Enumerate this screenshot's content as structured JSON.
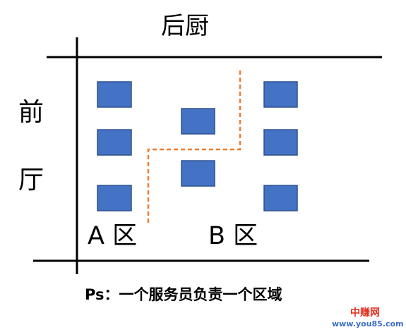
{
  "diagram": {
    "kitchen_label": "后厨",
    "front_hall_label_line1": "前",
    "front_hall_label_line2": "厅",
    "zone_a_label": "A 区",
    "zone_b_label": "B 区",
    "note": "Ps：一个服务员负责一个区域"
  },
  "watermark": {
    "site_name": "中赚网",
    "url": "www.you85.com"
  },
  "colors": {
    "table_fill": "#4472c4",
    "table_stroke": "#2f528f",
    "divider_line": "#ed7d31",
    "wall_line": "#000000",
    "watermark_red": "#e0301e",
    "watermark_blue": "#3a6fc4"
  }
}
